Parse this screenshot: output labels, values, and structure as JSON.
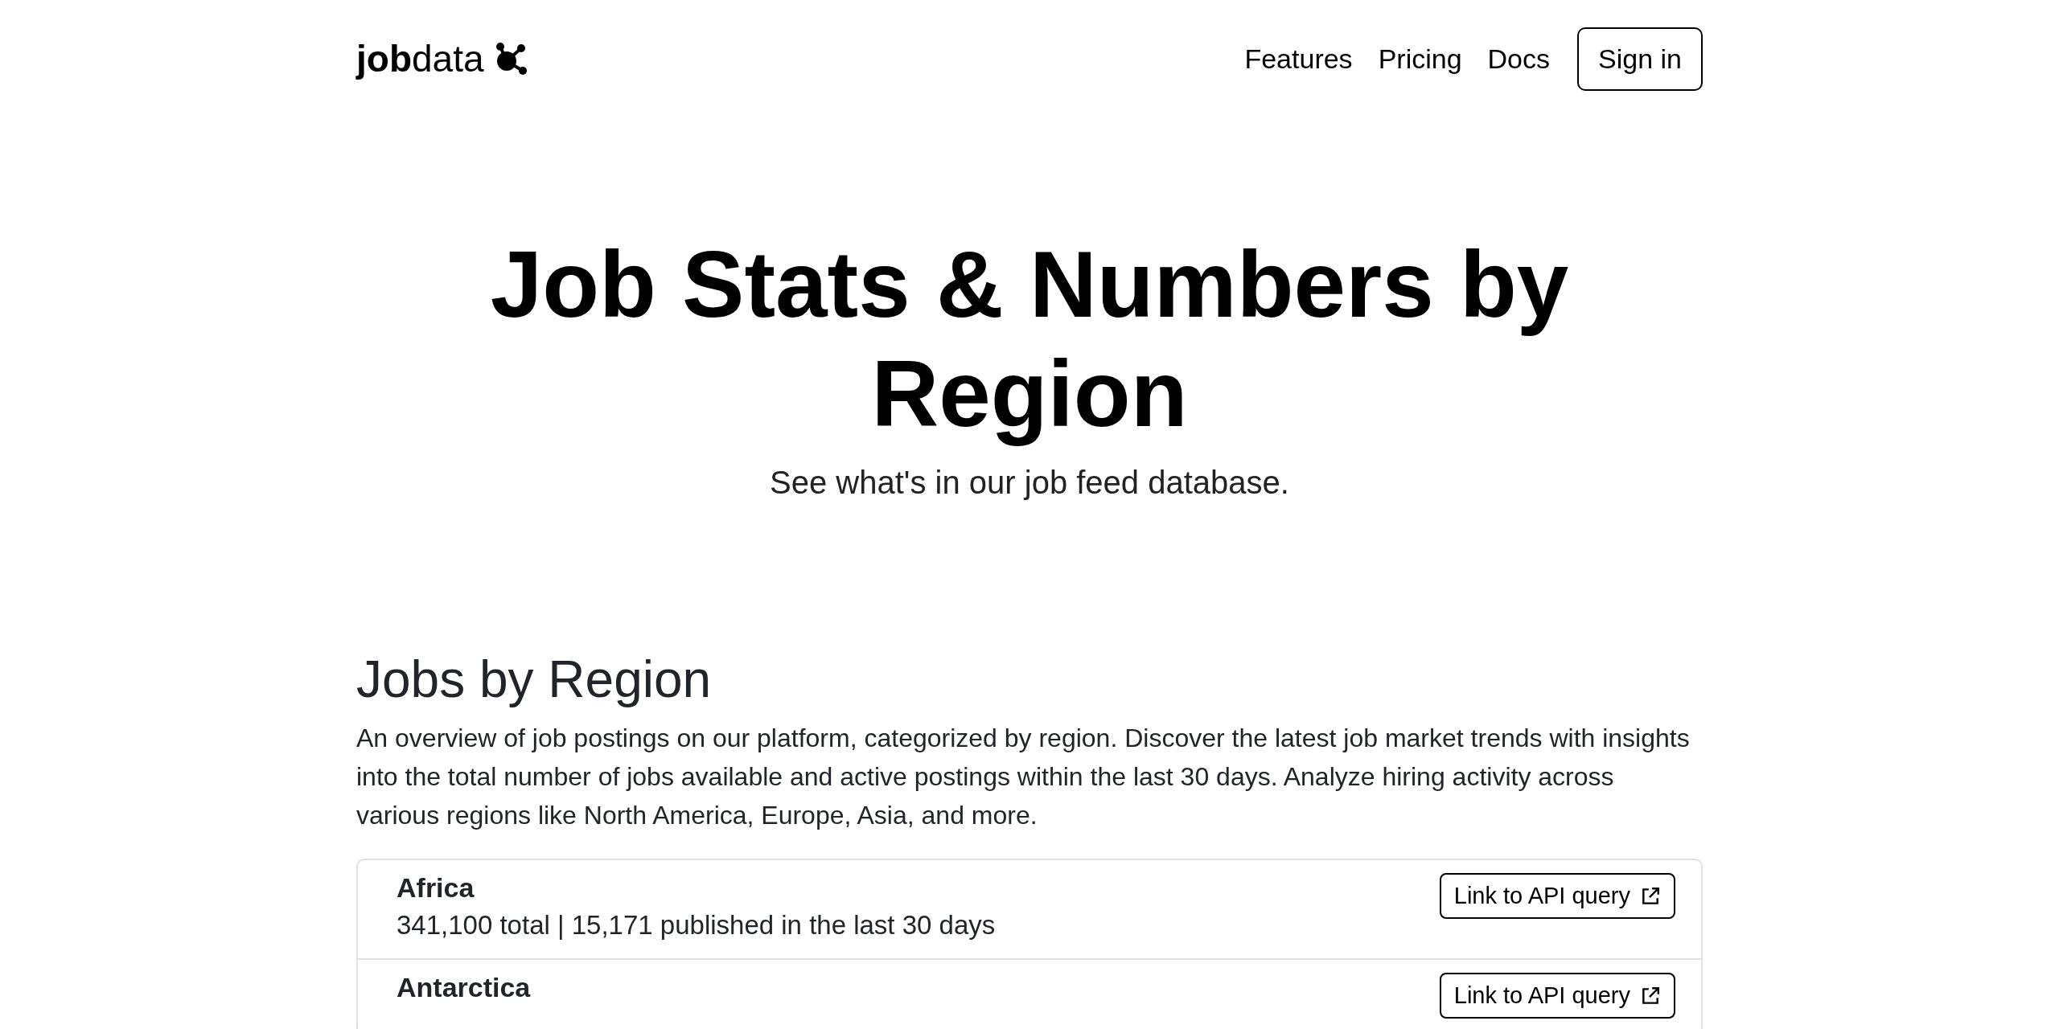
{
  "header": {
    "logo_bold": "job",
    "logo_light": "data",
    "nav": [
      "Features",
      "Pricing",
      "Docs"
    ],
    "sign_in": "Sign in"
  },
  "hero": {
    "title": "Job Stats & Numbers by Region",
    "subtitle": "See what's in our job feed database."
  },
  "section": {
    "title": "Jobs by Region",
    "description": "An overview of job postings on our platform, categorized by region. Discover the latest job market trends with insights into the total number of jobs available and active postings within the last 30 days. Analyze hiring activity across various regions like North America, Europe, Asia, and more.",
    "regions": [
      {
        "name": "Africa",
        "stats": "341,100 total | 15,171 published in the last 30 days",
        "link": "Link to API query"
      },
      {
        "name": "Antarctica",
        "link": "Link to API query"
      }
    ]
  }
}
